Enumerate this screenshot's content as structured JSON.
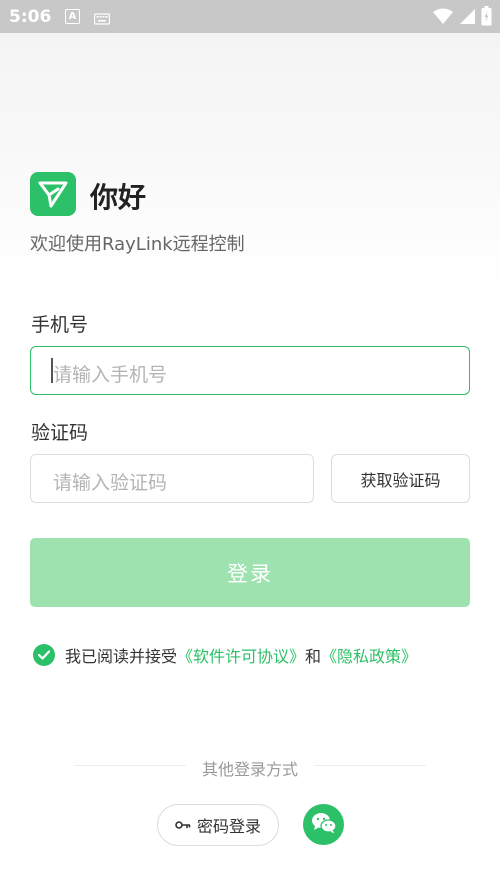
{
  "status_bar": {
    "time": "5:06",
    "a_label": "A"
  },
  "header": {
    "greeting": "你好",
    "subtitle": "欢迎使用RayLink远程控制"
  },
  "form": {
    "phone_label": "手机号",
    "phone_placeholder": "请输入手机号",
    "code_label": "验证码",
    "code_placeholder": "请输入验证码",
    "get_code_label": "获取验证码",
    "login_label": "登录"
  },
  "agreement": {
    "prefix": "我已阅读并接受",
    "license_link": "《软件许可协议》",
    "and": "和",
    "privacy_link": "《隐私政策》",
    "checked": true
  },
  "other_login": {
    "title": "其他登录方式",
    "password_login_label": "密码登录"
  },
  "colors": {
    "brand": "#2cc068",
    "login_disabled": "#9ee2b0"
  }
}
